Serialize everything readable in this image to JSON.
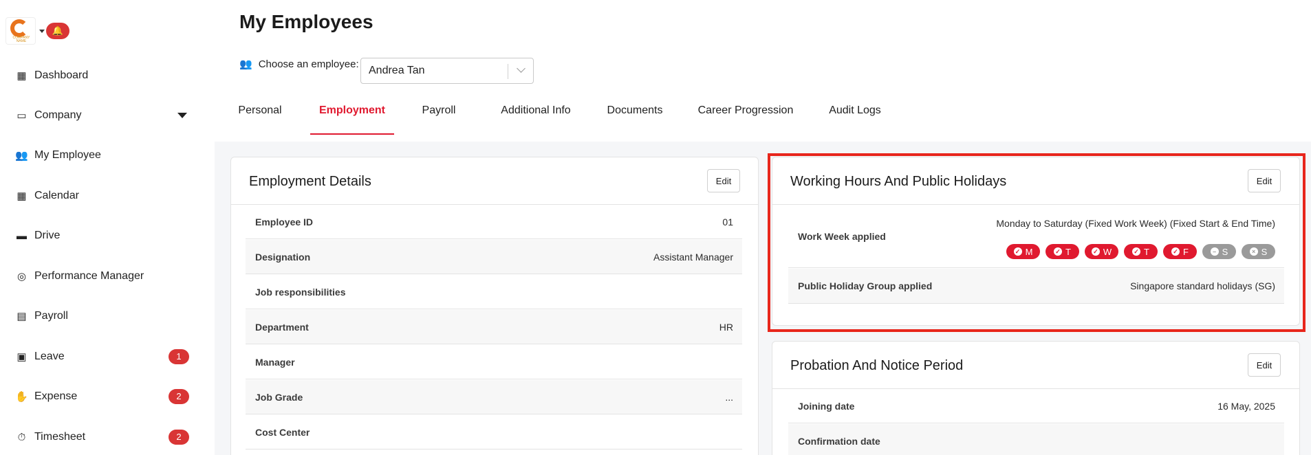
{
  "sidebar": {
    "logo_text": "COMPANY NAME",
    "items": [
      {
        "label": "Dashboard",
        "icon": "dashboard-icon",
        "glyph": "▦"
      },
      {
        "label": "Company",
        "icon": "archive-icon",
        "glyph": "▭"
      },
      {
        "label": "My Employee",
        "icon": "users-icon",
        "glyph": "👥"
      },
      {
        "label": "Calendar",
        "icon": "calendar-icon",
        "glyph": "▦"
      },
      {
        "label": "Drive",
        "icon": "folder-icon",
        "glyph": "▬"
      },
      {
        "label": "Performance Manager",
        "icon": "target-icon",
        "glyph": "◎"
      },
      {
        "label": "Payroll",
        "icon": "money-icon",
        "glyph": "▤"
      },
      {
        "label": "Leave",
        "icon": "calendar-plus-icon",
        "glyph": "▣",
        "badge": "1"
      },
      {
        "label": "Expense",
        "icon": "hand-coin-icon",
        "glyph": "✋",
        "badge": "2"
      },
      {
        "label": "Timesheet",
        "icon": "stopwatch-icon",
        "glyph": "⏱",
        "badge": "2"
      }
    ]
  },
  "header": {
    "title": "My Employees",
    "choose_label": "Choose an employee:",
    "selected_employee": "Andrea Tan"
  },
  "tabs": [
    "Personal",
    "Employment",
    "Payroll",
    "Additional Info",
    "Documents",
    "Career Progression",
    "Audit Logs"
  ],
  "active_tab": "Employment",
  "employment_details": {
    "title": "Employment Details",
    "edit": "Edit",
    "rows": [
      {
        "label": "Employee ID",
        "value": "01"
      },
      {
        "label": "Designation",
        "value": "Assistant Manager"
      },
      {
        "label": "Job responsibilities",
        "value": ""
      },
      {
        "label": "Department",
        "value": "HR"
      },
      {
        "label": "Manager",
        "value": ""
      },
      {
        "label": "Job Grade",
        "value": "..."
      },
      {
        "label": "Cost Center",
        "value": ""
      }
    ]
  },
  "working_hours": {
    "title": "Working Hours And Public Holidays",
    "edit": "Edit",
    "work_week_label": "Work Week applied",
    "work_week_value": "Monday to Saturday (Fixed Work Week) (Fixed Start & End Time)",
    "days": [
      {
        "day": "M",
        "state": "on"
      },
      {
        "day": "T",
        "state": "on"
      },
      {
        "day": "W",
        "state": "on"
      },
      {
        "day": "T",
        "state": "on"
      },
      {
        "day": "F",
        "state": "on"
      },
      {
        "day": "S",
        "state": "half"
      },
      {
        "day": "S",
        "state": "off"
      }
    ],
    "holiday_label": "Public Holiday Group applied",
    "holiday_value": "Singapore standard holidays (SG)"
  },
  "probation": {
    "title": "Probation And Notice Period",
    "edit": "Edit",
    "rows": [
      {
        "label": "Joining date",
        "value": "16 May, 2025"
      },
      {
        "label": "Confirmation date",
        "value": ""
      }
    ]
  },
  "colors": {
    "accent": "#e0192f",
    "badge": "#d93535",
    "highlight": "#e8261c"
  }
}
